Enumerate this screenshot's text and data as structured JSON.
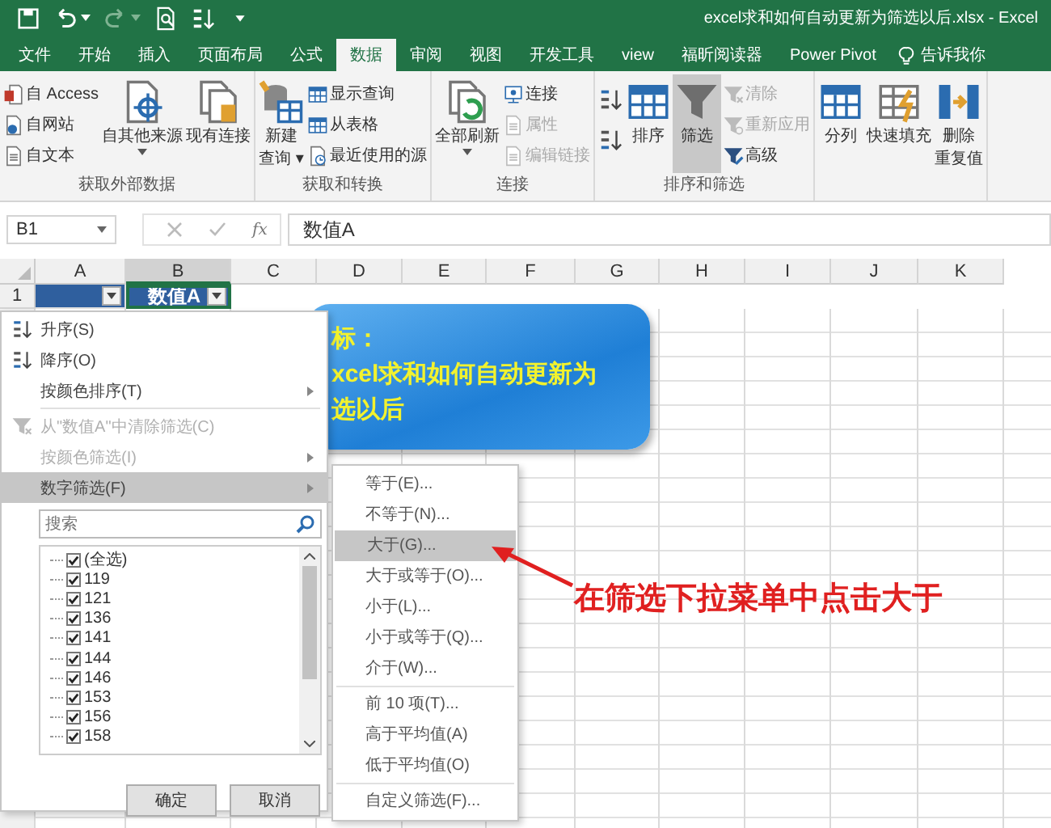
{
  "title_bar": {
    "title": "excel求和如何自动更新为筛选以后.xlsx  -  Excel"
  },
  "tabs": [
    {
      "label": "文件",
      "selected": false
    },
    {
      "label": "开始",
      "selected": false
    },
    {
      "label": "插入",
      "selected": false
    },
    {
      "label": "页面布局",
      "selected": false
    },
    {
      "label": "公式",
      "selected": false
    },
    {
      "label": "数据",
      "selected": true
    },
    {
      "label": "审阅",
      "selected": false
    },
    {
      "label": "视图",
      "selected": false
    },
    {
      "label": "开发工具",
      "selected": false
    },
    {
      "label": "view",
      "selected": false
    },
    {
      "label": "福昕阅读器",
      "selected": false
    },
    {
      "label": "Power Pivot",
      "selected": false
    }
  ],
  "tell_me": "告诉我你",
  "ribbon": [
    {
      "label": "获取外部数据",
      "items": [
        {
          "kind": "stack",
          "items": [
            {
              "label": "自 Access",
              "disabled": false
            },
            {
              "label": "自网站",
              "disabled": false
            },
            {
              "label": "自文本",
              "disabled": false
            }
          ]
        },
        {
          "kind": "large",
          "lines": [
            "自其他来源"
          ],
          "dropdown": true,
          "pressed": false
        },
        {
          "kind": "large",
          "lines": [
            "现有连接"
          ],
          "dropdown": false,
          "pressed": false
        }
      ]
    },
    {
      "label": "获取和转换",
      "items": [
        {
          "kind": "large",
          "lines": [
            "新建",
            "查询 ▾"
          ],
          "dropdown": false,
          "pressed": false
        },
        {
          "kind": "stack",
          "items": [
            {
              "label": "显示查询",
              "disabled": false
            },
            {
              "label": "从表格",
              "disabled": false
            },
            {
              "label": "最近使用的源",
              "disabled": false
            }
          ]
        }
      ]
    },
    {
      "label": "连接",
      "items": [
        {
          "kind": "large",
          "lines": [
            "全部刷新"
          ],
          "dropdown": true,
          "pressed": false
        },
        {
          "kind": "stack",
          "items": [
            {
              "label": "连接",
              "disabled": false
            },
            {
              "label": "属性",
              "disabled": true
            },
            {
              "label": "编辑链接",
              "disabled": true
            }
          ]
        }
      ]
    },
    {
      "label": "排序和筛选",
      "items": [
        {
          "kind": "icons"
        },
        {
          "kind": "large",
          "lines": [
            "排序"
          ],
          "dropdown": false,
          "pressed": false
        },
        {
          "kind": "large",
          "lines": [
            "筛选"
          ],
          "dropdown": false,
          "pressed": true
        },
        {
          "kind": "stack",
          "items": [
            {
              "label": "清除",
              "disabled": true
            },
            {
              "label": "重新应用",
              "disabled": true
            },
            {
              "label": "高级",
              "disabled": false
            }
          ]
        }
      ]
    },
    {
      "items": [
        {
          "kind": "large",
          "lines": [
            "分列"
          ],
          "dropdown": false,
          "pressed": false
        },
        {
          "kind": "large",
          "lines": [
            "快速填充"
          ],
          "dropdown": false,
          "pressed": false
        },
        {
          "kind": "large",
          "lines": [
            "删除",
            "重复值"
          ],
          "dropdown": false,
          "pressed": false
        }
      ]
    }
  ],
  "formula_bar": {
    "name_box": "B1",
    "function_label": "fx",
    "value": "数值A"
  },
  "sheet": {
    "columns": [
      {
        "label": "A",
        "selected": false
      },
      {
        "label": "B",
        "selected": true
      },
      {
        "label": "C",
        "selected": false
      },
      {
        "label": "D",
        "selected": false
      },
      {
        "label": "E",
        "selected": false
      },
      {
        "label": "F",
        "selected": false
      },
      {
        "label": "G",
        "selected": false
      },
      {
        "label": "H",
        "selected": false
      },
      {
        "label": "I",
        "selected": false
      },
      {
        "label": "J",
        "selected": false
      },
      {
        "label": "K",
        "selected": false
      }
    ],
    "rows": [
      {
        "number": "1",
        "cells": [
          {
            "filter_button": true,
            "selected": false
          },
          {
            "value": "数值A",
            "filter_button": true,
            "selected": true
          }
        ]
      }
    ]
  },
  "callout": {
    "lines": [
      "标：",
      "xcel求和如何自动更新为",
      "选以后"
    ]
  },
  "filter_menu": {
    "items": [
      {
        "label": "升序(S)",
        "submenu": false,
        "disabled": false,
        "selected": false,
        "separator_before": false
      },
      {
        "label": "降序(O)",
        "submenu": false,
        "disabled": false,
        "selected": false,
        "separator_before": false
      },
      {
        "label": "按颜色排序(T)",
        "submenu": true,
        "disabled": false,
        "selected": false,
        "separator_before": false
      },
      {
        "label": "从\"数值A\"中清除筛选(C)",
        "submenu": false,
        "disabled": true,
        "selected": false,
        "separator_before": true
      },
      {
        "label": "按颜色筛选(I)",
        "submenu": true,
        "disabled": true,
        "selected": false,
        "separator_before": false
      },
      {
        "label": "数字筛选(F)",
        "submenu": true,
        "disabled": false,
        "selected": true,
        "separator_before": false
      }
    ],
    "search_placeholder": "搜索",
    "values": [
      {
        "label": "(全选)",
        "checked": true
      },
      {
        "label": "119",
        "checked": true
      },
      {
        "label": "121",
        "checked": true
      },
      {
        "label": "136",
        "checked": true
      },
      {
        "label": "141",
        "checked": true
      },
      {
        "label": "144",
        "checked": true
      },
      {
        "label": "146",
        "checked": true
      },
      {
        "label": "153",
        "checked": true
      },
      {
        "label": "156",
        "checked": true
      },
      {
        "label": "158",
        "checked": true
      }
    ],
    "buttons": [
      "确定",
      "取消"
    ]
  },
  "number_filter_menu": [
    {
      "label": "等于(E)...",
      "selected": false,
      "separator_before": false
    },
    {
      "label": "不等于(N)...",
      "selected": false,
      "separator_before": false
    },
    {
      "label": "大于(G)...",
      "selected": true,
      "separator_before": false
    },
    {
      "label": "大于或等于(O)...",
      "selected": false,
      "separator_before": false
    },
    {
      "label": "小于(L)...",
      "selected": false,
      "separator_before": false
    },
    {
      "label": "小于或等于(Q)...",
      "selected": false,
      "separator_before": false
    },
    {
      "label": "介于(W)...",
      "selected": false,
      "separator_before": false
    },
    {
      "label": "前 10 项(T)...",
      "selected": false,
      "separator_before": true
    },
    {
      "label": "高于平均值(A)",
      "selected": false,
      "separator_before": false
    },
    {
      "label": "低于平均值(O)",
      "selected": false,
      "separator_before": false
    },
    {
      "label": "自定义筛选(F)...",
      "selected": false,
      "separator_before": true
    }
  ],
  "annotation": "在筛选下拉菜单中点击大于"
}
